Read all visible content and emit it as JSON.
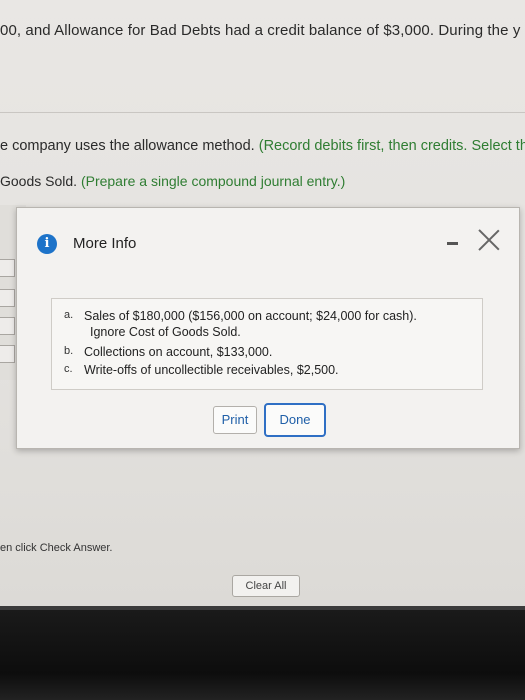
{
  "question": {
    "line1": "00, and Allowance for Bad Debts had a credit balance of $3,000. During the y",
    "line2_prefix": "e company uses the allowance method. ",
    "line2_green": "(Record debits first, then credits. Select th",
    "line3_prefix": "Goods Sold. ",
    "line3_green": "(Prepare a single compound journal entry.)"
  },
  "dialog": {
    "icon": "info-icon",
    "title": "More Info",
    "items": [
      {
        "letter": "a.",
        "text": "Sales of $180,000 ($156,000 on account; $24,000 for cash).",
        "sub": "Ignore Cost of Goods Sold."
      },
      {
        "letter": "b.",
        "text": "Collections on account, $133,000."
      },
      {
        "letter": "c.",
        "text": "Write-offs of uncollectible receivables, $2,500."
      }
    ],
    "print_label": "Print",
    "done_label": "Done"
  },
  "footer": {
    "instruction": "en click Check Answer.",
    "clear_label": "Clear All"
  },
  "colors": {
    "accent_green": "#2f7d32",
    "button_text_blue": "#1f5fa8",
    "info_icon_blue": "#1d73c9"
  }
}
